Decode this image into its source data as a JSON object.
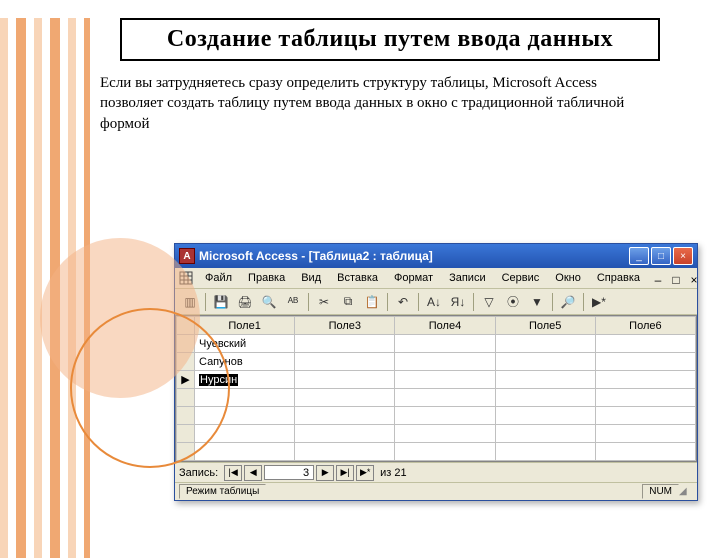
{
  "slide": {
    "title": "Создание таблицы путем ввода данных",
    "description": "Если вы затрудняетесь сразу определить структуру таблицы, Microsoft Access позволяет создать таблицу путем ввода данных в окно с традиционной табличной формой"
  },
  "window": {
    "app_icon": "A",
    "title": "Microsoft Access - [Таблица2 : таблица]",
    "minimize": "_",
    "maximize": "□",
    "close": "×"
  },
  "menu": {
    "items": [
      "Файл",
      "Правка",
      "Вид",
      "Вставка",
      "Формат",
      "Записи",
      "Сервис",
      "Окно",
      "Справка"
    ],
    "doc_min": "–",
    "doc_max": "□",
    "doc_close": "×"
  },
  "columns": [
    "",
    "Поле1",
    "Поле3",
    "Поле4",
    "Поле5",
    "Поле6"
  ],
  "rows": [
    {
      "sel": "",
      "c1": "Чуевский",
      "c3": "",
      "c4": "",
      "c5": "",
      "c6": ""
    },
    {
      "sel": "",
      "c1": "Сапунов",
      "c3": "",
      "c4": "",
      "c5": "",
      "c6": ""
    },
    {
      "sel": "▶",
      "c1": "Нурсин",
      "c3": "",
      "c4": "",
      "c5": "",
      "c6": "",
      "editing": true
    },
    {
      "sel": "",
      "c1": "",
      "c3": "",
      "c4": "",
      "c5": "",
      "c6": ""
    },
    {
      "sel": "",
      "c1": "",
      "c3": "",
      "c4": "",
      "c5": "",
      "c6": ""
    },
    {
      "sel": "",
      "c1": "",
      "c3": "",
      "c4": "",
      "c5": "",
      "c6": ""
    },
    {
      "sel": "",
      "c1": "",
      "c3": "",
      "c4": "",
      "c5": "",
      "c6": ""
    }
  ],
  "nav": {
    "label": "Запись:",
    "first": "|◀",
    "prev": "◀",
    "current": "3",
    "next": "▶",
    "last": "▶|",
    "new": "▶*",
    "of": "из",
    "total": "21"
  },
  "status": {
    "mode": "Режим таблицы",
    "num": "NUM"
  }
}
